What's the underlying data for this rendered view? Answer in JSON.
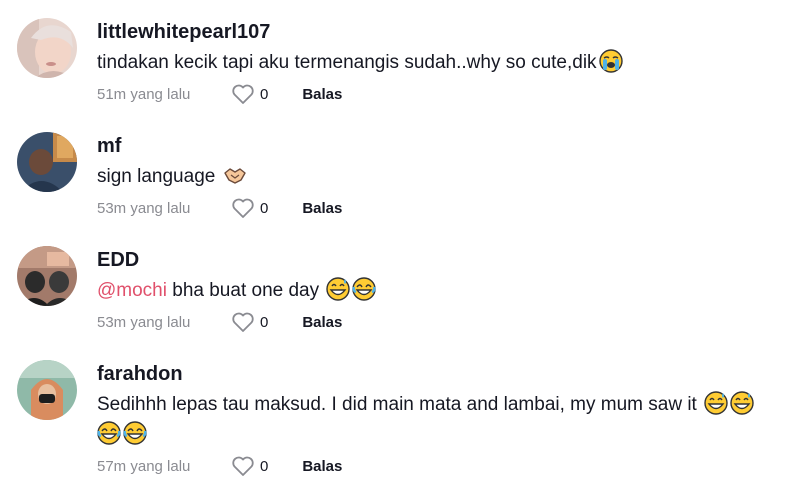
{
  "comments": [
    {
      "username": "littlewhitepearl107",
      "text": "tindakan kecik tapi aku termenangis sudah..why so cute,dik",
      "emoji": "loudly-crying-face",
      "time": "51m yang lalu",
      "likes": "0",
      "reply": "Balas"
    },
    {
      "username": "mf",
      "text": "sign language",
      "emoji": "handshake",
      "time": "53m yang lalu",
      "likes": "0",
      "reply": "Balas"
    },
    {
      "username": "EDD",
      "mention": "@mochi",
      "text": " bha buat one day",
      "emoji": "grinning-face-with-sweat, face-with-tears-of-joy",
      "time": "53m yang lalu",
      "likes": "0",
      "reply": "Balas"
    },
    {
      "username": "farahdon",
      "text": "Sedihhh lepas tau maksud. I did main mata and lambai, my mum saw it",
      "emoji": "grinning-face-with-sweat, grinning-face-with-sweat, face-with-tears-of-joy, face-with-tears-of-joy",
      "time": "57m yang lalu",
      "likes": "0",
      "reply": "Balas"
    }
  ],
  "colors": {
    "mention": "#e0506b",
    "muted": "#8a8b91",
    "text": "#161823"
  }
}
